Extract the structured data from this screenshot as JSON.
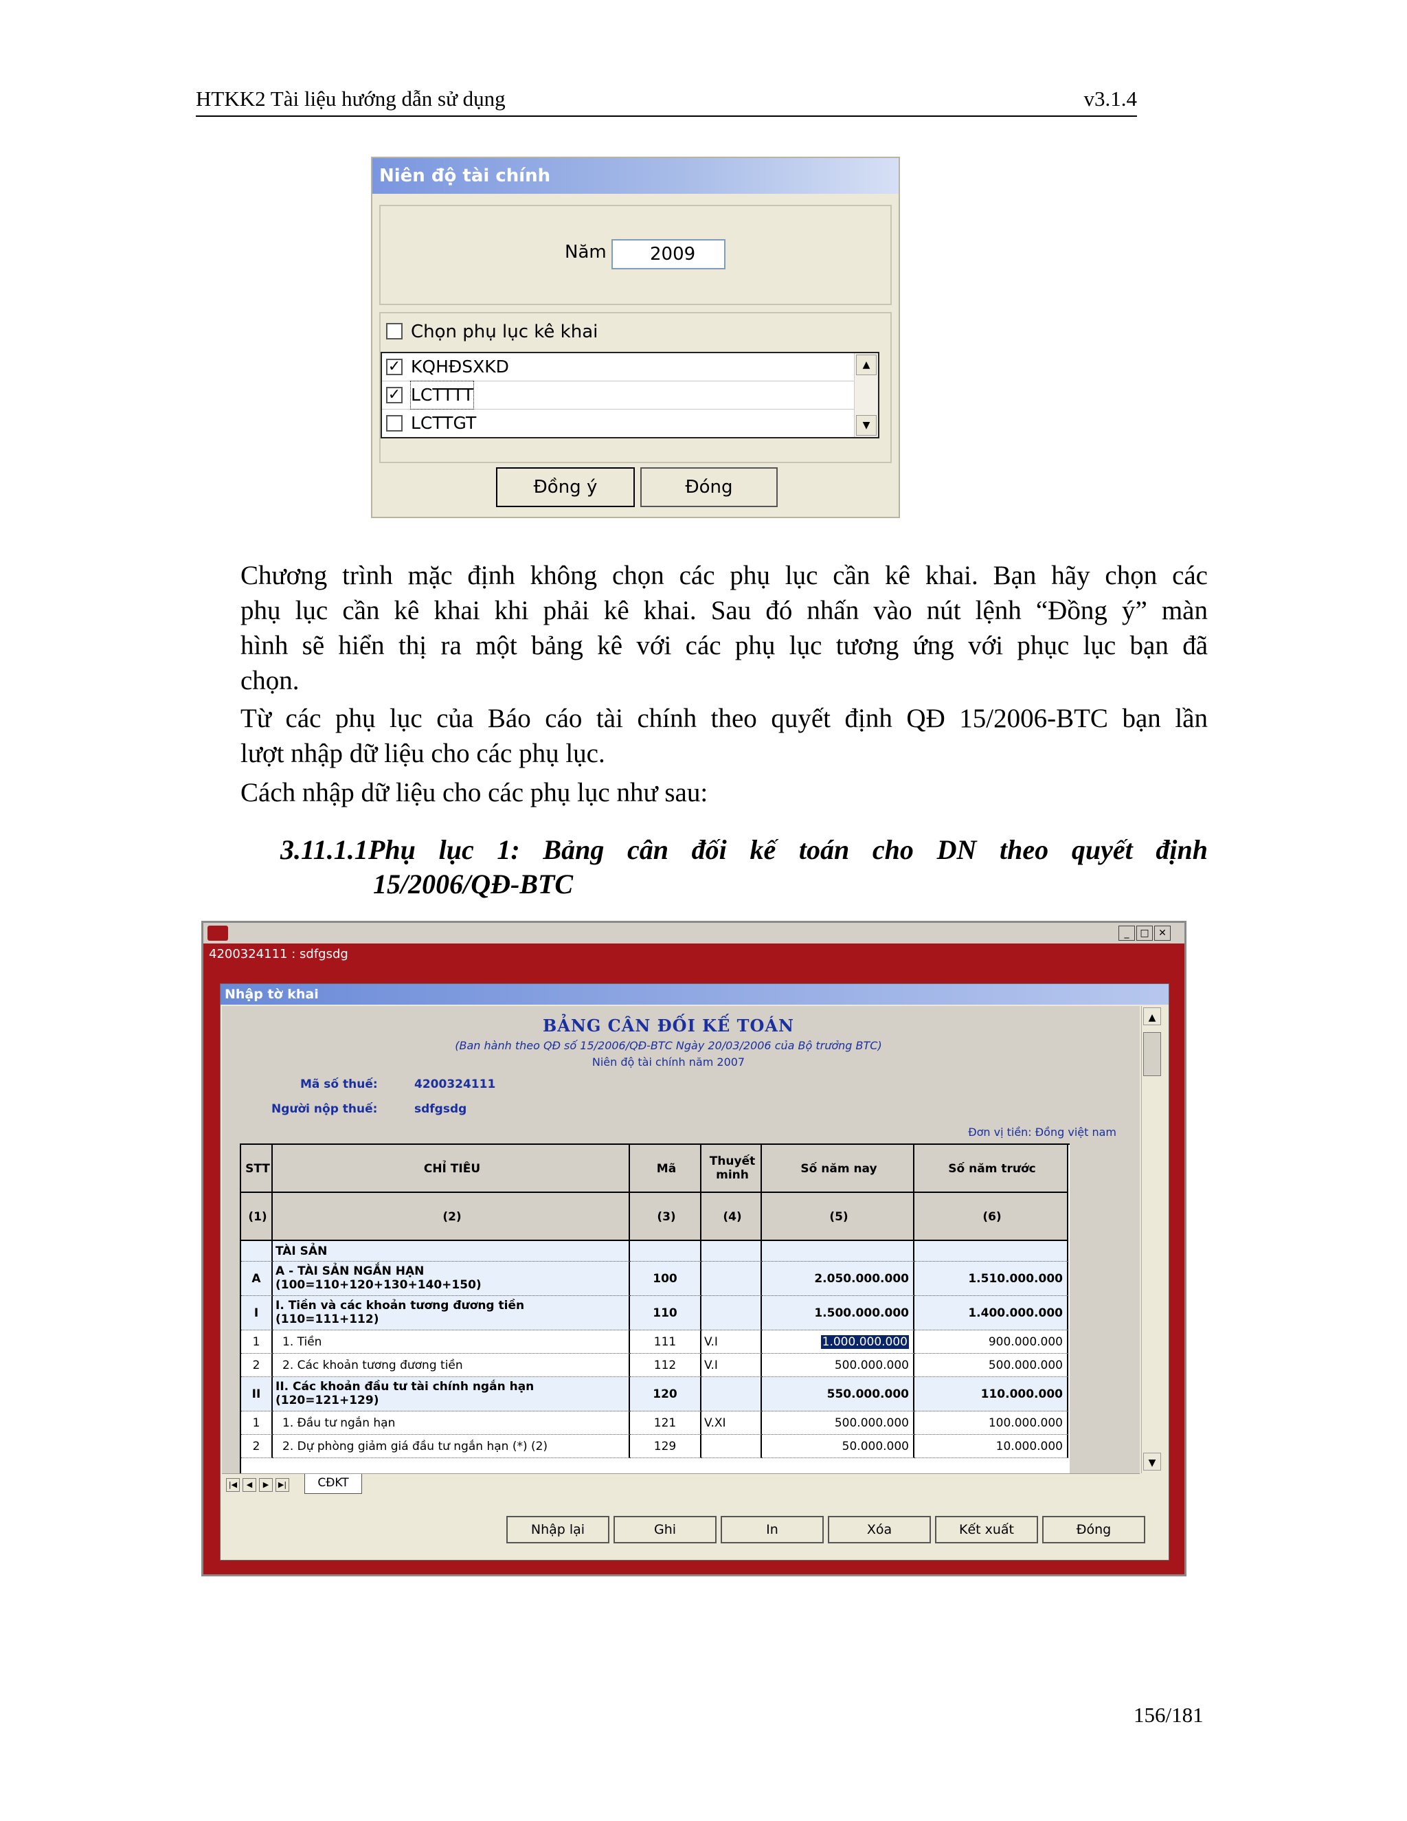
{
  "doc_header": {
    "title": "HTKK2 Tài liệu hướng dẫn sử dụng",
    "version": "v3.1.4"
  },
  "dialog": {
    "title": "Niên độ tài chính",
    "year_label": "Năm",
    "year_value": "2009",
    "select_appendix_label": "Chọn phụ lục kê khai",
    "items": [
      {
        "label": "KQHĐSXKD",
        "checked": true
      },
      {
        "label": "LCTTTT",
        "checked": true
      },
      {
        "label": "LCTTGT",
        "checked": false
      }
    ],
    "ok_button": "Đồng ý",
    "close_button": "Đóng"
  },
  "paragraphs": {
    "p1_lines": [
      "Chương trình mặc định không chọn các phụ lục cần kê khai. Bạn hãy chọn các",
      "phụ lục cần kê khai khi phải kê khai. Sau đó nhấn vào nút lệnh “Đồng ý” màn",
      "hình sẽ hiển thị ra một bảng kê với các phụ lục tương ứng với phục lục bạn đã"
    ],
    "p1_last": "chọn.",
    "p2_line1": "Từ các phụ lục của Báo cáo tài chính theo quyết định QĐ 15/2006-BTC  bạn lần",
    "p2_line2": "lượt nhập dữ liệu cho các phụ lục.",
    "p3": "Cách nhập dữ liệu cho các phụ lục như sau:"
  },
  "heading": {
    "number": "3.11.1.1",
    "line1": "Phụ lục 1: Bảng cân đối kế toán cho DN theo quyết định",
    "line2": "15/2006/QĐ-BTC"
  },
  "window": {
    "taxpayer_bar": "4200324111 : sdfgsdg",
    "panel_title": "Nhập tờ khai",
    "form_title": "BẢNG CÂN ĐỐI KẾ TOÁN",
    "form_subtitle": "(Ban hành theo QĐ số 15/2006/QĐ-BTC Ngày 20/03/2006 của Bộ trưởng BTC)",
    "fiscal_year": "Niên độ tài chính năm 2007",
    "tax_code_label": "Mã số thuế:",
    "tax_code": "4200324111",
    "payer_label": "Người nộp thuế:",
    "payer": "sdfgsdg",
    "currency": "Đơn vị tiền: Đồng việt nam",
    "columns": [
      "STT",
      "CHỈ TIÊU",
      "Mã",
      "Thuyết minh",
      "Số năm nay",
      "Số năm trước"
    ],
    "col_numbers": [
      "(1)",
      "(2)",
      "(3)",
      "(4)",
      "(5)",
      "(6)"
    ],
    "section_label": "TÀI SẢN",
    "rows": [
      {
        "stt": "A",
        "name1": "A - TÀI SẢN NGẮN HẠN",
        "name2": "(100=110+120+130+140+150)",
        "code": "100",
        "note": "",
        "current": "2.050.000.000",
        "prior": "1.510.000.000"
      },
      {
        "stt": "I",
        "name1": "I. Tiền và các khoản tương đương tiền",
        "name2": "(110=111+112)",
        "code": "110",
        "note": "",
        "current": "1.500.000.000",
        "prior": "1.400.000.000"
      },
      {
        "stt": "1",
        "name1": "1. Tiền",
        "name2": "",
        "code": "111",
        "note": "V.I",
        "current": "1.000.000.000",
        "prior": "900.000.000"
      },
      {
        "stt": "2",
        "name1": "2. Các khoản tương đương tiền",
        "name2": "",
        "code": "112",
        "note": "V.I",
        "current": "500.000.000",
        "prior": "500.000.000"
      },
      {
        "stt": "II",
        "name1": "II. Các khoản đầu tư tài chính ngắn hạn",
        "name2": "(120=121+129)",
        "code": "120",
        "note": "",
        "current": "550.000.000",
        "prior": "110.000.000"
      },
      {
        "stt": "1",
        "name1": "1. Đầu tư ngắn hạn",
        "name2": "",
        "code": "121",
        "note": "V.XI",
        "current": "500.000.000",
        "prior": "100.000.000"
      },
      {
        "stt": "2",
        "name1": "2. Dự phòng giảm giá đầu tư ngắn hạn (*) (2)",
        "name2": "",
        "code": "129",
        "note": "",
        "current": "50.000.000",
        "prior": "10.000.000"
      }
    ],
    "sheet_tab": "CĐKT",
    "buttons": [
      "Nhập lại",
      "Ghi",
      "In",
      "Xóa",
      "Kết xuất",
      "Đóng"
    ]
  },
  "footer": {
    "page": "156/181"
  }
}
